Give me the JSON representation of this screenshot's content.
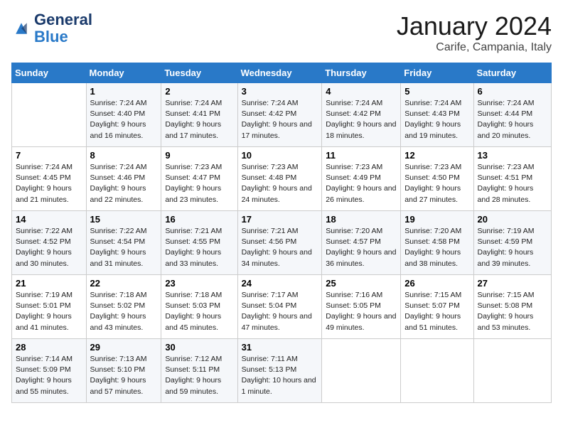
{
  "header": {
    "logo_general": "General",
    "logo_blue": "Blue",
    "month_title": "January 2024",
    "location": "Carife, Campania, Italy"
  },
  "columns": [
    "Sunday",
    "Monday",
    "Tuesday",
    "Wednesday",
    "Thursday",
    "Friday",
    "Saturday"
  ],
  "rows": [
    [
      {
        "day": "",
        "sunrise": "",
        "sunset": "",
        "daylight": ""
      },
      {
        "day": "1",
        "sunrise": "Sunrise: 7:24 AM",
        "sunset": "Sunset: 4:40 PM",
        "daylight": "Daylight: 9 hours and 16 minutes."
      },
      {
        "day": "2",
        "sunrise": "Sunrise: 7:24 AM",
        "sunset": "Sunset: 4:41 PM",
        "daylight": "Daylight: 9 hours and 17 minutes."
      },
      {
        "day": "3",
        "sunrise": "Sunrise: 7:24 AM",
        "sunset": "Sunset: 4:42 PM",
        "daylight": "Daylight: 9 hours and 17 minutes."
      },
      {
        "day": "4",
        "sunrise": "Sunrise: 7:24 AM",
        "sunset": "Sunset: 4:42 PM",
        "daylight": "Daylight: 9 hours and 18 minutes."
      },
      {
        "day": "5",
        "sunrise": "Sunrise: 7:24 AM",
        "sunset": "Sunset: 4:43 PM",
        "daylight": "Daylight: 9 hours and 19 minutes."
      },
      {
        "day": "6",
        "sunrise": "Sunrise: 7:24 AM",
        "sunset": "Sunset: 4:44 PM",
        "daylight": "Daylight: 9 hours and 20 minutes."
      }
    ],
    [
      {
        "day": "7",
        "sunrise": "Sunrise: 7:24 AM",
        "sunset": "Sunset: 4:45 PM",
        "daylight": "Daylight: 9 hours and 21 minutes."
      },
      {
        "day": "8",
        "sunrise": "Sunrise: 7:24 AM",
        "sunset": "Sunset: 4:46 PM",
        "daylight": "Daylight: 9 hours and 22 minutes."
      },
      {
        "day": "9",
        "sunrise": "Sunrise: 7:23 AM",
        "sunset": "Sunset: 4:47 PM",
        "daylight": "Daylight: 9 hours and 23 minutes."
      },
      {
        "day": "10",
        "sunrise": "Sunrise: 7:23 AM",
        "sunset": "Sunset: 4:48 PM",
        "daylight": "Daylight: 9 hours and 24 minutes."
      },
      {
        "day": "11",
        "sunrise": "Sunrise: 7:23 AM",
        "sunset": "Sunset: 4:49 PM",
        "daylight": "Daylight: 9 hours and 26 minutes."
      },
      {
        "day": "12",
        "sunrise": "Sunrise: 7:23 AM",
        "sunset": "Sunset: 4:50 PM",
        "daylight": "Daylight: 9 hours and 27 minutes."
      },
      {
        "day": "13",
        "sunrise": "Sunrise: 7:23 AM",
        "sunset": "Sunset: 4:51 PM",
        "daylight": "Daylight: 9 hours and 28 minutes."
      }
    ],
    [
      {
        "day": "14",
        "sunrise": "Sunrise: 7:22 AM",
        "sunset": "Sunset: 4:52 PM",
        "daylight": "Daylight: 9 hours and 30 minutes."
      },
      {
        "day": "15",
        "sunrise": "Sunrise: 7:22 AM",
        "sunset": "Sunset: 4:54 PM",
        "daylight": "Daylight: 9 hours and 31 minutes."
      },
      {
        "day": "16",
        "sunrise": "Sunrise: 7:21 AM",
        "sunset": "Sunset: 4:55 PM",
        "daylight": "Daylight: 9 hours and 33 minutes."
      },
      {
        "day": "17",
        "sunrise": "Sunrise: 7:21 AM",
        "sunset": "Sunset: 4:56 PM",
        "daylight": "Daylight: 9 hours and 34 minutes."
      },
      {
        "day": "18",
        "sunrise": "Sunrise: 7:20 AM",
        "sunset": "Sunset: 4:57 PM",
        "daylight": "Daylight: 9 hours and 36 minutes."
      },
      {
        "day": "19",
        "sunrise": "Sunrise: 7:20 AM",
        "sunset": "Sunset: 4:58 PM",
        "daylight": "Daylight: 9 hours and 38 minutes."
      },
      {
        "day": "20",
        "sunrise": "Sunrise: 7:19 AM",
        "sunset": "Sunset: 4:59 PM",
        "daylight": "Daylight: 9 hours and 39 minutes."
      }
    ],
    [
      {
        "day": "21",
        "sunrise": "Sunrise: 7:19 AM",
        "sunset": "Sunset: 5:01 PM",
        "daylight": "Daylight: 9 hours and 41 minutes."
      },
      {
        "day": "22",
        "sunrise": "Sunrise: 7:18 AM",
        "sunset": "Sunset: 5:02 PM",
        "daylight": "Daylight: 9 hours and 43 minutes."
      },
      {
        "day": "23",
        "sunrise": "Sunrise: 7:18 AM",
        "sunset": "Sunset: 5:03 PM",
        "daylight": "Daylight: 9 hours and 45 minutes."
      },
      {
        "day": "24",
        "sunrise": "Sunrise: 7:17 AM",
        "sunset": "Sunset: 5:04 PM",
        "daylight": "Daylight: 9 hours and 47 minutes."
      },
      {
        "day": "25",
        "sunrise": "Sunrise: 7:16 AM",
        "sunset": "Sunset: 5:05 PM",
        "daylight": "Daylight: 9 hours and 49 minutes."
      },
      {
        "day": "26",
        "sunrise": "Sunrise: 7:15 AM",
        "sunset": "Sunset: 5:07 PM",
        "daylight": "Daylight: 9 hours and 51 minutes."
      },
      {
        "day": "27",
        "sunrise": "Sunrise: 7:15 AM",
        "sunset": "Sunset: 5:08 PM",
        "daylight": "Daylight: 9 hours and 53 minutes."
      }
    ],
    [
      {
        "day": "28",
        "sunrise": "Sunrise: 7:14 AM",
        "sunset": "Sunset: 5:09 PM",
        "daylight": "Daylight: 9 hours and 55 minutes."
      },
      {
        "day": "29",
        "sunrise": "Sunrise: 7:13 AM",
        "sunset": "Sunset: 5:10 PM",
        "daylight": "Daylight: 9 hours and 57 minutes."
      },
      {
        "day": "30",
        "sunrise": "Sunrise: 7:12 AM",
        "sunset": "Sunset: 5:11 PM",
        "daylight": "Daylight: 9 hours and 59 minutes."
      },
      {
        "day": "31",
        "sunrise": "Sunrise: 7:11 AM",
        "sunset": "Sunset: 5:13 PM",
        "daylight": "Daylight: 10 hours and 1 minute."
      },
      {
        "day": "",
        "sunrise": "",
        "sunset": "",
        "daylight": ""
      },
      {
        "day": "",
        "sunrise": "",
        "sunset": "",
        "daylight": ""
      },
      {
        "day": "",
        "sunrise": "",
        "sunset": "",
        "daylight": ""
      }
    ]
  ]
}
